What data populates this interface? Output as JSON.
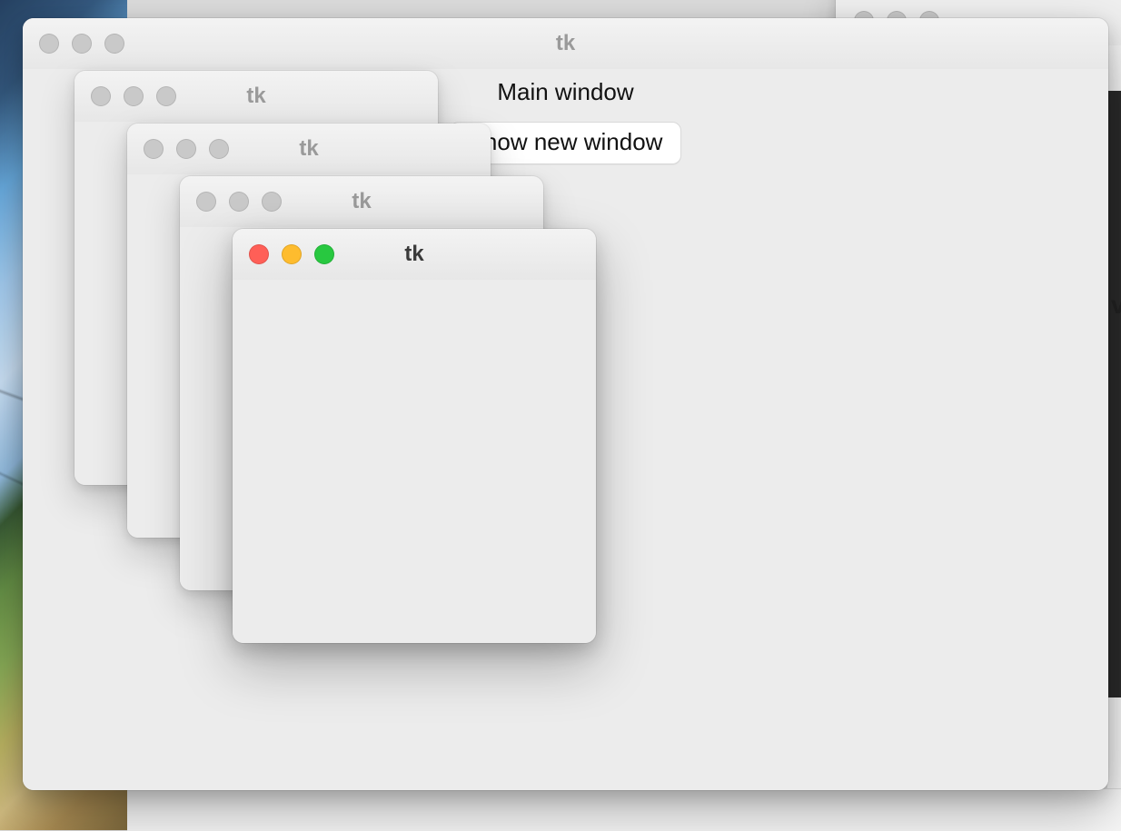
{
  "background_window_far_right": {
    "title": ""
  },
  "main_window": {
    "title": "tk",
    "heading": "Main window",
    "button_label": "Show new window"
  },
  "child_windows": [
    {
      "title": "tk",
      "active": false
    },
    {
      "title": "tk",
      "active": false
    },
    {
      "title": "tk",
      "active": false
    },
    {
      "title": "tk",
      "active": true
    }
  ],
  "right_edge_letter": "v",
  "button_visible_fragment": "now new window"
}
